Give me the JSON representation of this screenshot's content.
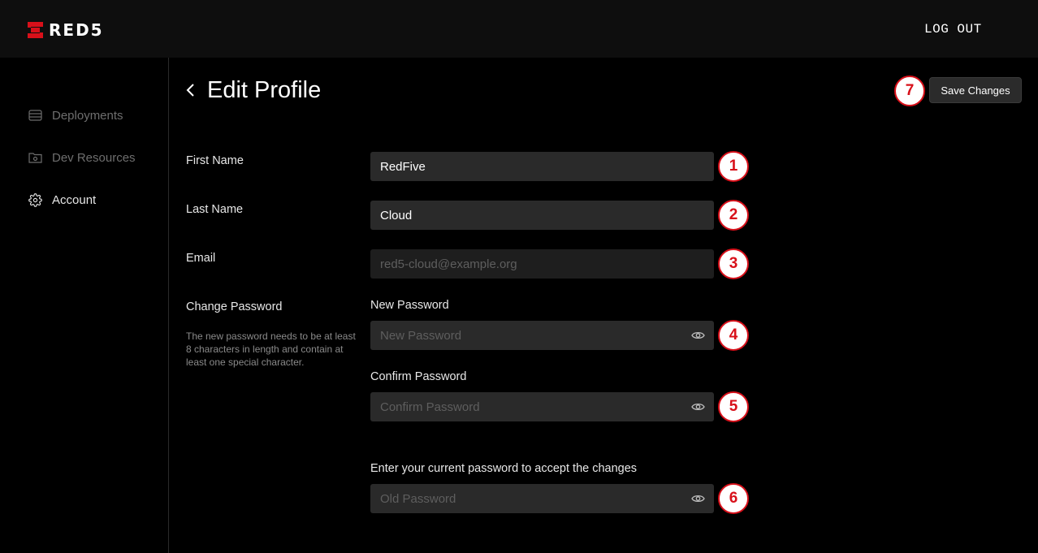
{
  "app": {
    "brand": "RED5",
    "logout_label": "LOG OUT"
  },
  "sidebar": {
    "items": [
      {
        "label": "Deployments",
        "icon": "deployments-icon",
        "active": false
      },
      {
        "label": "Dev Resources",
        "icon": "folder-icon",
        "active": false
      },
      {
        "label": "Account",
        "icon": "gear-icon",
        "active": true
      }
    ]
  },
  "header": {
    "title": "Edit Profile",
    "save_label": "Save Changes"
  },
  "form": {
    "first_name": {
      "label": "First Name",
      "value": "RedFive"
    },
    "last_name": {
      "label": "Last Name",
      "value": "Cloud"
    },
    "email": {
      "label": "Email",
      "value": "red5-cloud@example.org"
    },
    "change_password": {
      "label": "Change Password",
      "hint": "The new password needs to be at least 8 characters in length and contain at least one special character."
    },
    "new_password": {
      "label": "New Password",
      "placeholder": "New Password"
    },
    "confirm_password": {
      "label": "Confirm Password",
      "placeholder": "Confirm Password"
    },
    "old_password": {
      "label": "Enter your current password to accept the changes",
      "placeholder": "Old Password"
    }
  },
  "markers": [
    "1",
    "2",
    "3",
    "4",
    "5",
    "6",
    "7"
  ],
  "colors": {
    "brand_red": "#d8101a",
    "background": "#000000",
    "field": "#2a2a2a"
  }
}
